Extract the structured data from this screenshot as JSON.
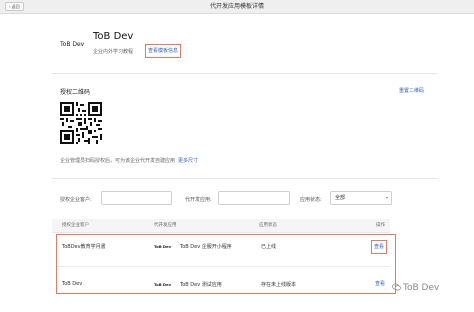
{
  "header": {
    "back_label": "返回",
    "title": "代开发应用模板详情"
  },
  "template": {
    "logo_text": "ToB Dev",
    "app_name": "ToB Dev",
    "description": "企业内外学习教程",
    "view_info_link": "查看模板信息"
  },
  "qr_section": {
    "title": "授权二维码",
    "reset_link": "重置二维码",
    "hint": "企业管理员扫码授权后，可为该企业代开发自建应用",
    "more_link": "更多尺寸"
  },
  "filters": {
    "customer_label": "授权企业客户:",
    "customer_value": "",
    "app_label": "代开发应用:",
    "app_value": "",
    "status_label": "应用状态:",
    "status_value": "全部"
  },
  "table": {
    "headers": [
      "授权企业客户",
      "代开发应用",
      "应用状态",
      "操作"
    ],
    "rows": [
      {
        "customer": "ToBDev教育学月書",
        "app_logo": "ToB Dev",
        "app": "ToB Dev 企服开小程序",
        "status": "已上线",
        "action": "查看"
      },
      {
        "customer": "ToB Dev",
        "app_logo": "ToB Dev",
        "app": "ToB Dev 测试应用",
        "status": "存在未上线版本",
        "action": "查看"
      }
    ]
  },
  "watermark": {
    "text": "ToB Dev"
  },
  "colors": {
    "link": "#2a62c8",
    "highlight": "#e8795f"
  }
}
